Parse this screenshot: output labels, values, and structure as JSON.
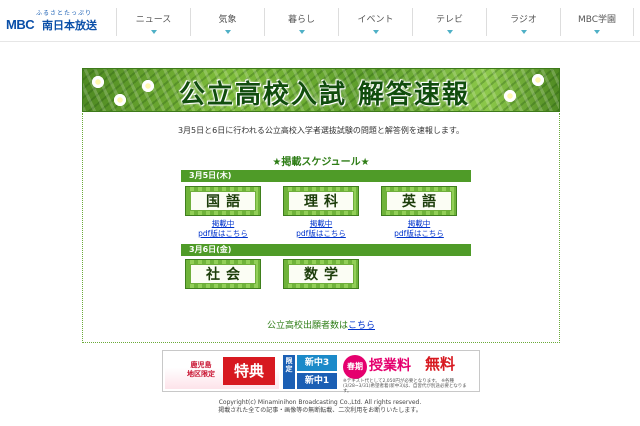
{
  "header": {
    "logo_kana": "ふるさとたっぷり",
    "logo_mark": "MBC",
    "logo_name": "南日本放送",
    "nav": [
      "ニュース",
      "気象",
      "暮らし",
      "イベント",
      "テレビ",
      "ラジオ",
      "MBC学園"
    ]
  },
  "banner": {
    "title": "公立高校入試 解答速報"
  },
  "content": {
    "intro": "3月5日と6日に行われる公立高校入学者選抜試験の問題と解答例を速報します。",
    "schedule_title": "★掲載スケジュール★",
    "day1": {
      "date": "3月5日(木)",
      "subjects": [
        {
          "name": "国語",
          "status": "掲載中",
          "pdf": "pdf版はこちら"
        },
        {
          "name": "理科",
          "status": "掲載中",
          "pdf": "pdf版はこちら"
        },
        {
          "name": "英語",
          "status": "掲載中",
          "pdf": "pdf版はこちら"
        }
      ]
    },
    "day2": {
      "date": "3月6日(金)",
      "subjects": [
        {
          "name": "社会"
        },
        {
          "name": "数学"
        }
      ]
    },
    "applicants_text": "公立高校出願者数は",
    "applicants_link": "こちら"
  },
  "ad": {
    "region": "鹿児島\n地区限定",
    "special": "特典",
    "limited": "限定",
    "grade_top": "新中3",
    "grade_bottom": "新中1",
    "spring": "春期",
    "fee": "授業料",
    "free": "無料",
    "note": "※テキスト代として2,050円が必要となります。 ※各種(3/28~3/31)希望者着(新中3)は、自習代が別途必要となります。"
  },
  "footer": {
    "copyright": "Copyright(c) Minaminihon Broadcasting Co.,Ltd. All rights reserved.",
    "notice": "掲載された全ての記事・画像等の無断転載、二次利用をお断りいたします。"
  }
}
